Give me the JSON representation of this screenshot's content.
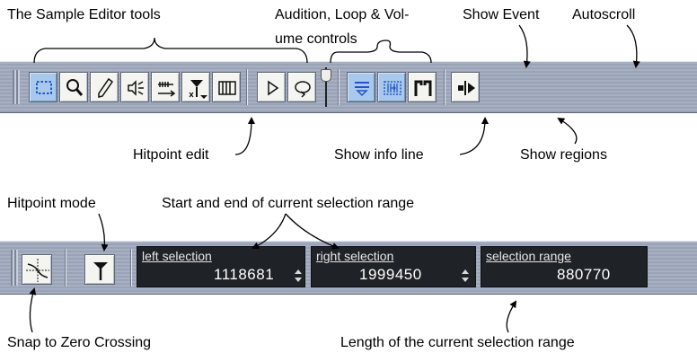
{
  "captions": {
    "sample_editor_tools": "The Sample Editor tools",
    "audition_line1": "Audition, Loop & Vol-",
    "audition_line2": "ume controls",
    "show_event": "Show Event",
    "autoscroll": "Autoscroll",
    "hitpoint_edit": "Hitpoint edit",
    "show_info_line": "Show info line",
    "show_regions": "Show regions",
    "hitpoint_mode": "Hitpoint mode",
    "start_end_selection": "Start and end of current selection range",
    "snap_zero_crossing": "Snap to Zero Crossing",
    "length_selection": "Length of the current selection range"
  },
  "toolbar": {
    "tools": [
      {
        "icon": "range-select-icon",
        "active": true
      },
      {
        "icon": "magnifier-icon",
        "active": false
      },
      {
        "icon": "pencil-icon",
        "active": false
      },
      {
        "icon": "speaker-play-icon",
        "active": false
      },
      {
        "icon": "scrub-icon",
        "active": false
      },
      {
        "icon": "hitpoint-edit-icon",
        "active": false
      },
      {
        "icon": "grid-icon",
        "active": false
      }
    ],
    "audition": [
      "play-icon",
      "loop-icon",
      "volume-slider"
    ],
    "view": [
      {
        "icon": "info-line-icon",
        "active": true
      },
      {
        "icon": "event-icon",
        "active": true
      },
      {
        "icon": "regions-icon",
        "active": false
      }
    ],
    "autoscroll_icon": "autoscroll-icon"
  },
  "infobar": {
    "snap_icon": "zero-crossing-icon",
    "hitpoint_mode_icon": "hitpoint-mode-icon",
    "left_selection": {
      "label": "left selection",
      "value": "1118681"
    },
    "right_selection": {
      "label": "right selection",
      "value": "1999450"
    },
    "selection_range": {
      "label": "selection range",
      "value": "880770"
    }
  },
  "colors": {
    "toolbar_bg": "#a1aabc",
    "button_face": "#f4f4f0",
    "button_active": "#a9c9ec",
    "icon_blue": "#1f55c8",
    "display_bg": "#1f2226"
  }
}
